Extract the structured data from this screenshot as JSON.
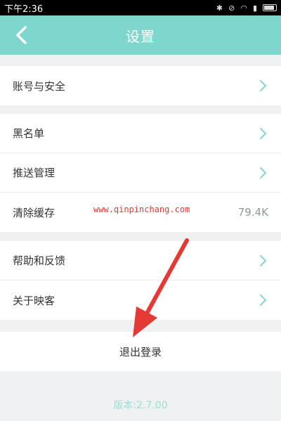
{
  "status_bar": {
    "time": "下午2:36"
  },
  "header": {
    "title": "设置",
    "back_icon": "chevron-left-icon"
  },
  "groups": [
    {
      "items": [
        {
          "label": "账号与安全"
        }
      ]
    },
    {
      "items": [
        {
          "label": "黑名单"
        },
        {
          "label": "推送管理"
        },
        {
          "label": "清除缓存",
          "value": "79.4K"
        }
      ]
    },
    {
      "items": [
        {
          "label": "帮助和反馈"
        },
        {
          "label": "关于映客"
        }
      ]
    }
  ],
  "watermark": "www.qinpinchang.com",
  "logout_label": "退出登录",
  "version": "版本:2.7.00",
  "colors": {
    "accent": "#7fd6cc",
    "annotation_arrow": "#e53935"
  }
}
